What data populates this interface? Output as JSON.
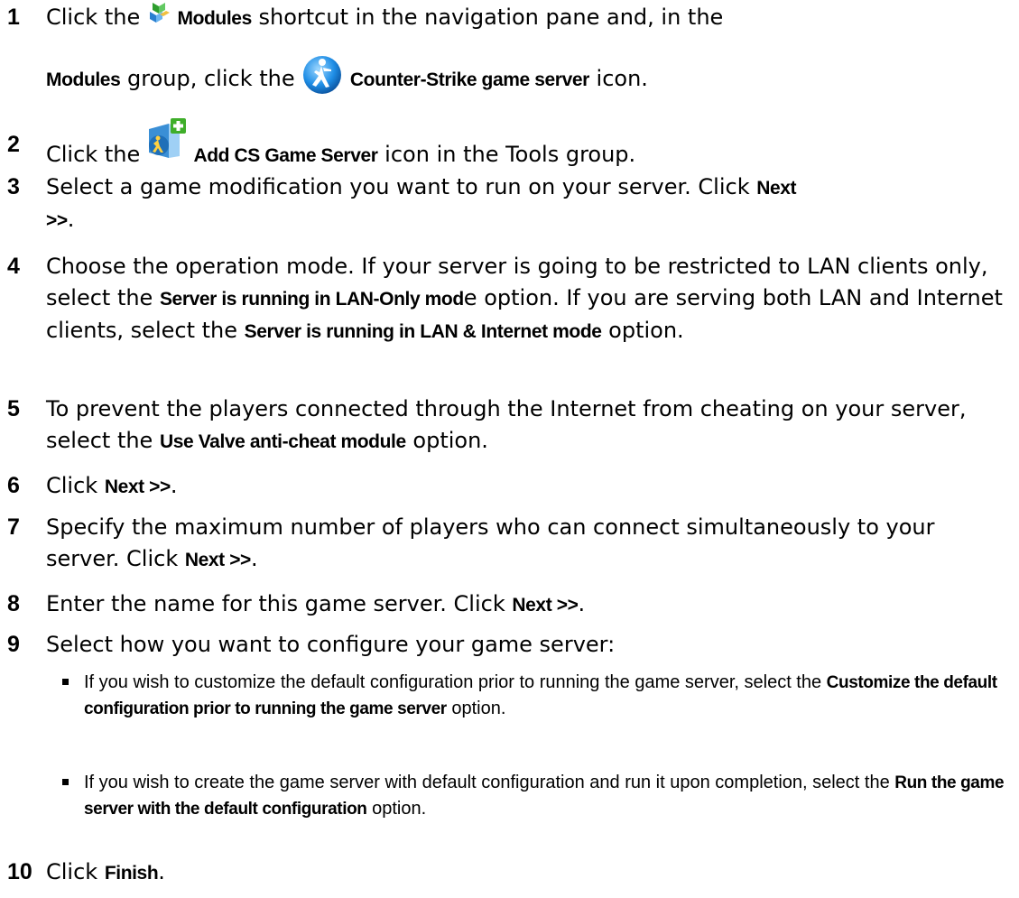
{
  "steps": [
    {
      "num": "1",
      "t1": "Click the ",
      "b1": "Modules",
      "t2": " shortcut in the navigation pane and, in the",
      "b2": "Modules",
      "t3": " group, click the ",
      "b3": "Counter-Strike game server",
      "t4": " icon."
    },
    {
      "num": "2",
      "t1": "Click the ",
      "b1": "Add CS Game Server",
      "t2": " icon in the Tools group."
    },
    {
      "num": "3",
      "t1": "Select a game modification you want to run on your server. Click ",
      "b1": "Next",
      "b2": ">>",
      "t2": "."
    },
    {
      "num": "4",
      "t1": "Choose the operation mode. If your server is going to be restricted to LAN clients only, select the ",
      "b1": "Server is running in LAN-Only mod",
      "t2": "e option. If you are serving both LAN and Internet clients, select the ",
      "b2": "Server is running in LAN & Internet mode",
      "t3": " option."
    },
    {
      "num": "5",
      "t1": "To prevent the players connected through the Internet from cheating on your server, select the ",
      "b1": "Use Valve anti-cheat module",
      "t2": " option."
    },
    {
      "num": "6",
      "t1": "Click ",
      "b1": "Next >>",
      "t2": "."
    },
    {
      "num": "7",
      "t1": "Specify the maximum number of players who can connect simultaneously to your server. Click ",
      "b1": "Next >>",
      "t2": "."
    },
    {
      "num": "8",
      "t1": "Enter the name for this game server. Click ",
      "b1": "Next >>",
      "t2": "."
    },
    {
      "num": "9",
      "t1": "Select how you want to configure your game server:"
    },
    {
      "num": "10",
      "t1": "Click ",
      "b1": "Finish",
      "t2": "."
    }
  ],
  "bullets": [
    {
      "t1": "If you wish to customize the default configuration prior to running the game server, select the ",
      "b1": "Customize the default configuration prior to running the game server",
      "t2": " option."
    },
    {
      "t1": "If you wish to create the game server with default configuration and run it upon completion, select the ",
      "b1": "Run the game server with the default configuration",
      "t2": " option."
    }
  ],
  "icons": {
    "modules": "modules-icon",
    "counter_strike": "counter-strike-icon",
    "add_cs_server": "add-cs-game-server-icon"
  }
}
